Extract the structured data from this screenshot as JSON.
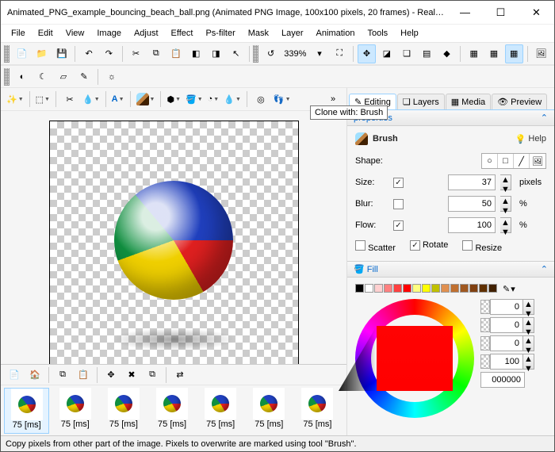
{
  "title": "Animated_PNG_example_bouncing_beach_ball.png (Animated PNG Image, 100x100 pixels, 20 frames) - RealWorl...",
  "menu": [
    "File",
    "Edit",
    "View",
    "Image",
    "Adjust",
    "Effect",
    "Ps-filter",
    "Mask",
    "Layer",
    "Animation",
    "Tools",
    "Help"
  ],
  "zoom": "339%",
  "tooltip": "Clone with: Brush",
  "tabs": {
    "editing": "Editing",
    "layers": "Layers",
    "media": "Media",
    "preview": "Preview"
  },
  "section_props": "properties",
  "brush": {
    "title": "Brush",
    "help": "Help",
    "shape_lbl": "Shape:",
    "size_lbl": "Size:",
    "size_val": "37",
    "size_unit": "pixels",
    "blur_lbl": "Blur:",
    "blur_val": "50",
    "blur_unit": "%",
    "flow_lbl": "Flow:",
    "flow_val": "100",
    "flow_unit": "%",
    "scatter": "Scatter",
    "rotate": "Rotate",
    "resize": "Resize",
    "size_chk": true,
    "blur_chk": false,
    "flow_chk": true,
    "scatter_chk": false,
    "rotate_chk": true,
    "resize_chk": false
  },
  "fill": {
    "title": "Fill",
    "swatches": [
      "#000000",
      "#ffffff",
      "#ffd0d0",
      "#ff8080",
      "#ff4040",
      "#ff0000",
      "#ffff80",
      "#ffff00",
      "#c0c000",
      "#e09050",
      "#c07030",
      "#a05820",
      "#804010",
      "#603000",
      "#402000"
    ],
    "c0": "0",
    "c1": "0",
    "c2": "0",
    "c3": "100",
    "hex": "000000"
  },
  "frames": {
    "duration": "75 [ms]",
    "count": 7
  },
  "status": "Copy pixels from other part of the image. Pixels to overwrite are marked using tool \"Brush\"."
}
